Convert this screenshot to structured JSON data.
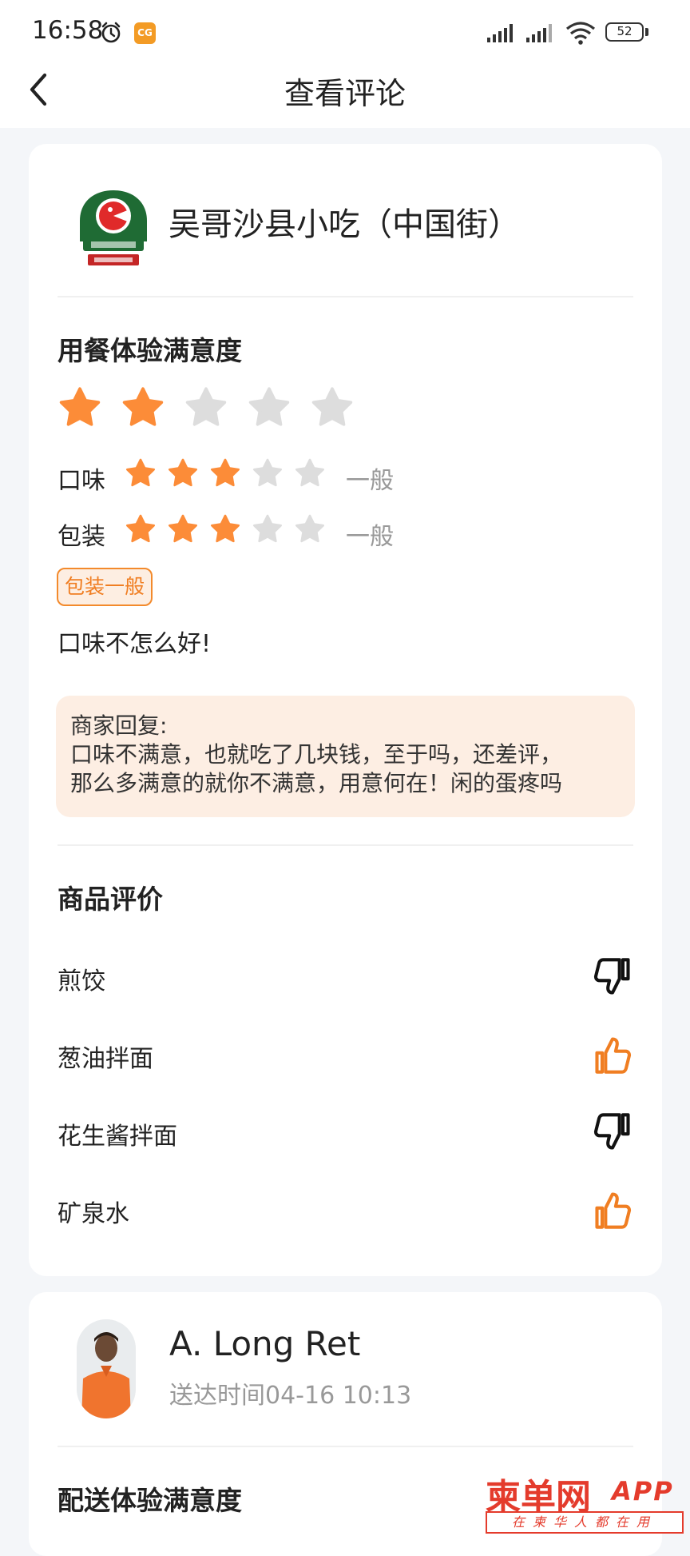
{
  "status_bar": {
    "time": "16:58",
    "app_badge": "CG",
    "battery": "52",
    "icons": [
      "alarm-icon",
      "signal-icon",
      "signal-icon",
      "wifi-icon",
      "battery-icon"
    ]
  },
  "header": {
    "title": "查看评论",
    "back_icon": "chevron-left-icon"
  },
  "review": {
    "shop_name": "吴哥沙县小吃（中国街）",
    "satisfaction_title": "用餐体验满意度",
    "overall_rating": 2,
    "rating_max": 5,
    "sub_ratings": [
      {
        "label": "口味",
        "stars": 3,
        "text": "一般"
      },
      {
        "label": "包装",
        "stars": 3,
        "text": "一般"
      }
    ],
    "tag": "包装一般",
    "comment": "口味不怎么好!",
    "merchant_reply": {
      "label": "商家回复:",
      "line1": "口味不满意，也就吃了几块钱，至于吗，还差评，",
      "line2": "那么多满意的就你不满意，用意何在！闲的蛋疼吗"
    },
    "products_title": "商品评价",
    "products": [
      {
        "name": "煎饺",
        "vote": "thumbs-down"
      },
      {
        "name": "葱油拌面",
        "vote": "thumbs-up"
      },
      {
        "name": "花生酱拌面",
        "vote": "thumbs-down"
      },
      {
        "name": "矿泉水",
        "vote": "thumbs-up"
      }
    ]
  },
  "delivery": {
    "rider_name": "A. Long Ret",
    "delivery_time": "送达时间04-16 10:13",
    "satisfaction_title": "配送体验满意度"
  },
  "watermark": {
    "main": "柬单网",
    "app": "APP",
    "sub": "在柬华人都在用"
  },
  "colors": {
    "star_active": "#fc8c38",
    "star_inactive": "#dddddd",
    "accent": "#f07e22",
    "reply_bg": "#fdeee3",
    "page_bg": "#f4f6f9"
  }
}
